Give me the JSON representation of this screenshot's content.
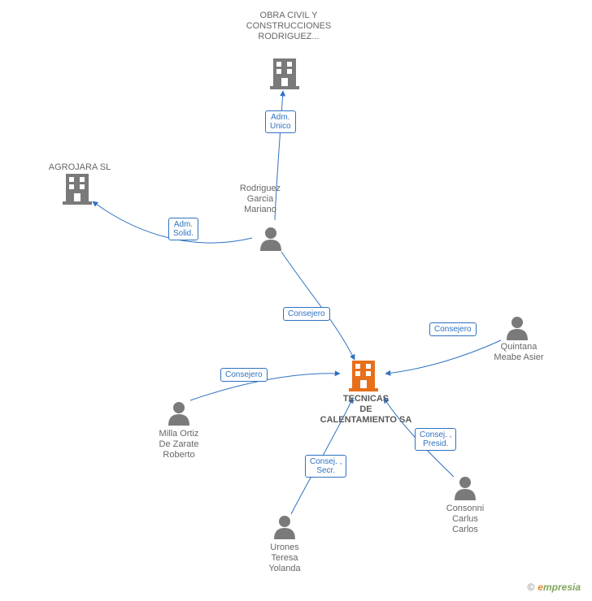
{
  "nodes": {
    "obra": {
      "label": "OBRA CIVIL Y\nCONSTRUCCIONES\nRODRIGUEZ..."
    },
    "agrojara": {
      "label": "AGROJARA SL"
    },
    "rodriguez": {
      "label": "Rodriguez\nGarcia\nMariano"
    },
    "tecnicas": {
      "label": "TECNICAS\nDE\nCALENTAMIENTO SA"
    },
    "milla": {
      "label": "Milla Ortiz\nDe Zarate\nRoberto"
    },
    "urones": {
      "label": "Urones\nTeresa\nYolanda"
    },
    "consonni": {
      "label": "Consonni\nCarlus\nCarlos"
    },
    "quintana": {
      "label": "Quintana\nMeabe Asier"
    }
  },
  "edges": {
    "adm_unico": "Adm.\nUnico",
    "adm_solid": "Adm.\nSolid.",
    "consejero": "Consejero",
    "consejero2": "Consejero",
    "consejero3": "Consejero",
    "consej_secr": "Consej. ,\nSecr.",
    "consej_presid": "Consej. ,\nPresid."
  },
  "footer": {
    "copyright_symbol": "©",
    "brand_first": "e",
    "brand_rest": "mpresia"
  },
  "colors": {
    "edge": "#2f72c1",
    "person": "#7a7a7a",
    "building": "#7a7a7a",
    "building_highlight": "#e86f1a"
  }
}
